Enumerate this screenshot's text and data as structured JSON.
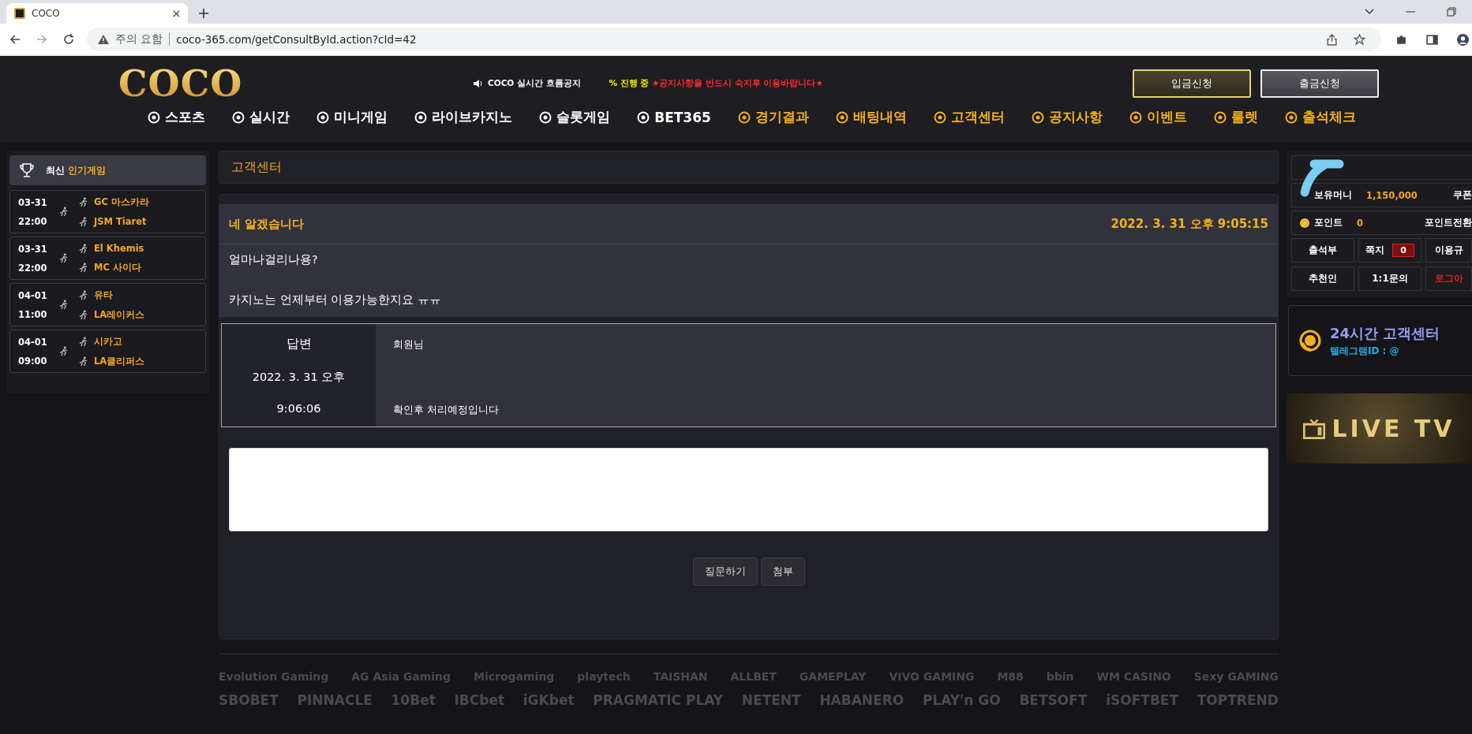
{
  "browser": {
    "tab_title": "COCO",
    "security_label": "주의 요함",
    "url": "coco-365.com/getConsultById.action?cId=42"
  },
  "header": {
    "logo": "COCO",
    "notice_label": "COCO 실시간 흐름공지",
    "ticker_prefix": "% 진행 중",
    "ticker": "★공지사항을 반드시 숙지후 이용바랍니다★",
    "buttons": [
      {
        "label": "입금신청",
        "kind": "deposit"
      },
      {
        "label": "출금신청",
        "kind": "withdraw"
      }
    ]
  },
  "nav": [
    {
      "label": "스포츠",
      "color": "#ffffff"
    },
    {
      "label": "실시간",
      "color": "#ffffff"
    },
    {
      "label": "미니게임",
      "color": "#ffffff"
    },
    {
      "label": "라이브카지노",
      "color": "#ffffff"
    },
    {
      "label": "슬롯게임",
      "color": "#ffffff"
    },
    {
      "label": "BET365",
      "color": "#ffffff"
    },
    {
      "label": "경기결과",
      "color": "#f5b21b"
    },
    {
      "label": "배팅내역",
      "color": "#f5b21b"
    },
    {
      "label": "고객센터",
      "color": "#f5b21b"
    },
    {
      "label": "공지사항",
      "color": "#f5b21b"
    },
    {
      "label": "이벤트",
      "color": "#f5b21b"
    },
    {
      "label": "룰렛",
      "color": "#f5b21b"
    },
    {
      "label": "출석체크",
      "color": "#f5b21b"
    }
  ],
  "sidebar": {
    "title_prefix": "최신",
    "title": "인기게임",
    "games": [
      {
        "date": "03-31",
        "time": "22:00",
        "home": "GC 마스카라",
        "away": "JSM Tiaret"
      },
      {
        "date": "03-31",
        "time": "22:00",
        "home": "El Khemis",
        "away": "MC 사이다"
      },
      {
        "date": "04-01",
        "time": "11:00",
        "home": "유타",
        "away": "LA레이커스"
      },
      {
        "date": "04-01",
        "time": "09:00",
        "home": "시카고",
        "away": "LA클리퍼스"
      }
    ]
  },
  "page_title": "고객센터",
  "inquiry": {
    "subject": "네 알겠습니다",
    "date": "2022. 3. 31 오후 9:05:15",
    "lines": [
      "얼마나걸리나용?",
      "카지노는 언제부터 이용가능한지요 ㅠㅠ"
    ]
  },
  "answer": {
    "label": "답변",
    "date": "2022. 3. 31 오후",
    "time": "9:06:06",
    "lines": [
      "회원님",
      "확인후 처리예정입니다"
    ]
  },
  "form": {
    "buttons": [
      "질문하기",
      "첨부"
    ]
  },
  "account": {
    "money_label": "보유머니",
    "money": "1,150,000",
    "coupon": "쿠폰",
    "point_label": "포인트",
    "points": "0",
    "point_convert": "포인트전환",
    "links": [
      {
        "label": "출석부",
        "kind": "plain"
      },
      {
        "label": "쪽지",
        "kind": "count",
        "count": "0"
      },
      {
        "label": "이용규",
        "kind": "plain"
      },
      {
        "label": "추천인",
        "kind": "plain"
      },
      {
        "label": "1:1문의",
        "kind": "plain"
      },
      {
        "label": "로그아",
        "kind": "logout"
      }
    ]
  },
  "support": {
    "title": "24시간 고객센터",
    "telegram": "텔레그램ID : @"
  },
  "live_tv": {
    "label": "LIVE TV"
  },
  "providers": [
    [
      "Evolution Gaming",
      "AG Asia Gaming",
      "Microgaming",
      "playtech",
      "TAISHAN",
      "ALLBET",
      "GAMEPLAY",
      "VIVO GAMING",
      "M88",
      "bbin",
      "WM CASINO",
      "Sexy GAMING"
    ],
    [
      "SBOBET",
      "PINNACLE",
      "10Bet",
      "IBCbet",
      "iGKbet",
      "PRAGMATIC PLAY",
      "NETENT",
      "HABANERO",
      "PLAY'n GO",
      "BETSOFT",
      "iSOFTBET",
      "TOPTREND"
    ]
  ]
}
